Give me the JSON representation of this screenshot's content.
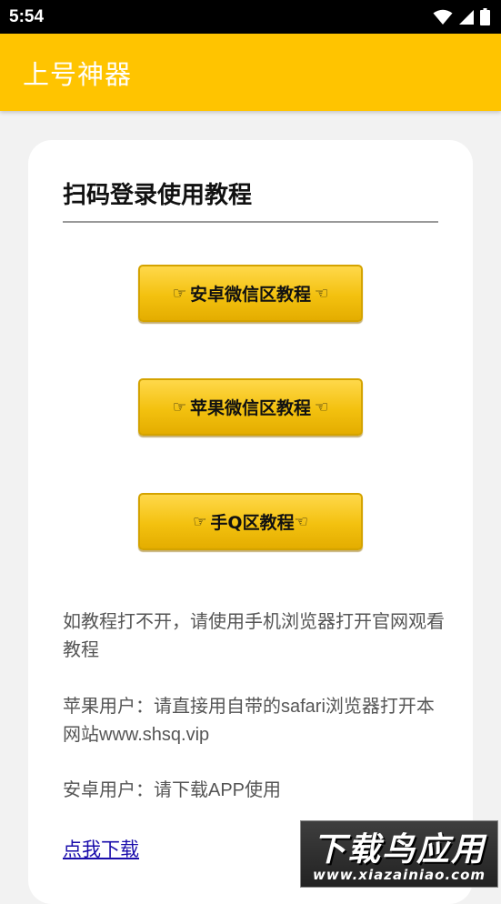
{
  "status_bar": {
    "time": "5:54"
  },
  "app_bar": {
    "title": "上号神器"
  },
  "card": {
    "title": "扫码登录使用教程",
    "buttons": [
      {
        "hand_left": "☞",
        "label": "安卓微信区教程",
        "hand_right": "☜"
      },
      {
        "hand_left": "☞",
        "label": "苹果微信区教程",
        "hand_right": "☜"
      },
      {
        "hand_left": "☞",
        "label": "手Q区教程",
        "hand_right": "☜"
      }
    ],
    "info_1": "如教程打不开，请使用手机浏览器打开官网观看教程",
    "info_2": "苹果用户：请直接用自带的safari浏览器打开本网站www.shsq.vip",
    "info_3": "安卓用户：请下载APP使用",
    "download_link": "点我下载"
  },
  "watermark": {
    "title": "下载鸟应用",
    "url": "www.xiazainiao.com"
  },
  "colors": {
    "accent": "#ffc400",
    "button": "#f3c10f",
    "link": "#1a0dab"
  }
}
